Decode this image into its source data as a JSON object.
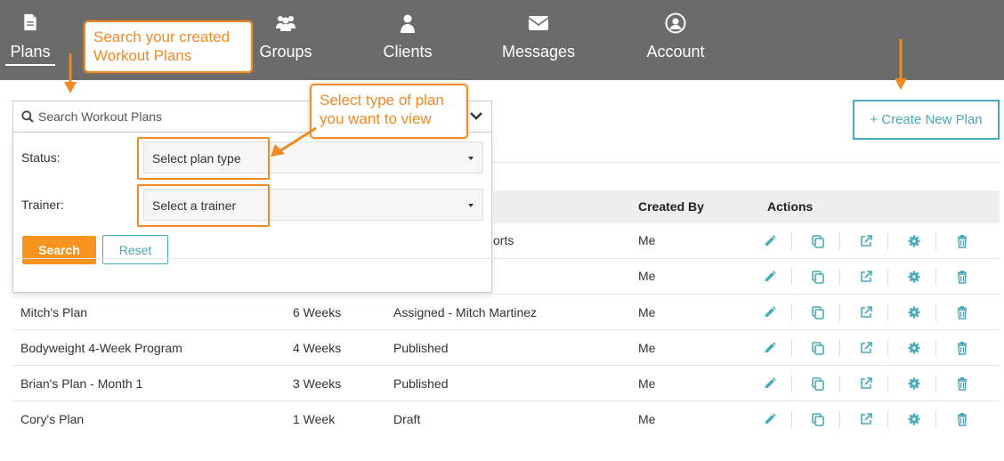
{
  "nav": {
    "items": [
      {
        "label": "Plans",
        "icon": "document-icon"
      },
      {
        "label": "Groups",
        "icon": "users-icon"
      },
      {
        "label": "Clients",
        "icon": "user-icon"
      },
      {
        "label": "Messages",
        "icon": "envelope-icon"
      },
      {
        "label": "Account",
        "icon": "account-circle-icon"
      }
    ]
  },
  "callouts": {
    "search": "Search your created Workout Plans",
    "plan_type": "Select type of plan you want to view"
  },
  "search": {
    "placeholder": "Search Workout Plans"
  },
  "filters": {
    "status_label": "Status:",
    "status_value": "Select plan type",
    "trainer_label": "Trainer:",
    "trainer_value": "Select a trainer",
    "search_button": "Search",
    "reset_button": "Reset"
  },
  "create_button": "+ Create New Plan",
  "table": {
    "headers": {
      "created_by": "Created By",
      "actions": "Actions"
    },
    "hidden_rows": [
      {
        "status_fragment": "orts",
        "created_by": "Me"
      },
      {
        "status_fragment": "",
        "created_by": "Me"
      }
    ],
    "rows": [
      {
        "name": "Mitch's Plan",
        "duration": "6 Weeks",
        "status": "Assigned - Mitch Martinez",
        "created_by": "Me"
      },
      {
        "name": "Bodyweight 4-Week Program",
        "duration": "4 Weeks",
        "status": "Published",
        "created_by": "Me"
      },
      {
        "name": "Brian's Plan - Month 1",
        "duration": "3 Weeks",
        "status": "Published",
        "created_by": "Me"
      },
      {
        "name": "Cory's Plan",
        "duration": "1 Week",
        "status": "Draft",
        "created_by": "Me"
      }
    ]
  },
  "colors": {
    "accent": "#f08a24",
    "teal": "#4aa9b9",
    "nav_bg": "#6b6b6b"
  }
}
